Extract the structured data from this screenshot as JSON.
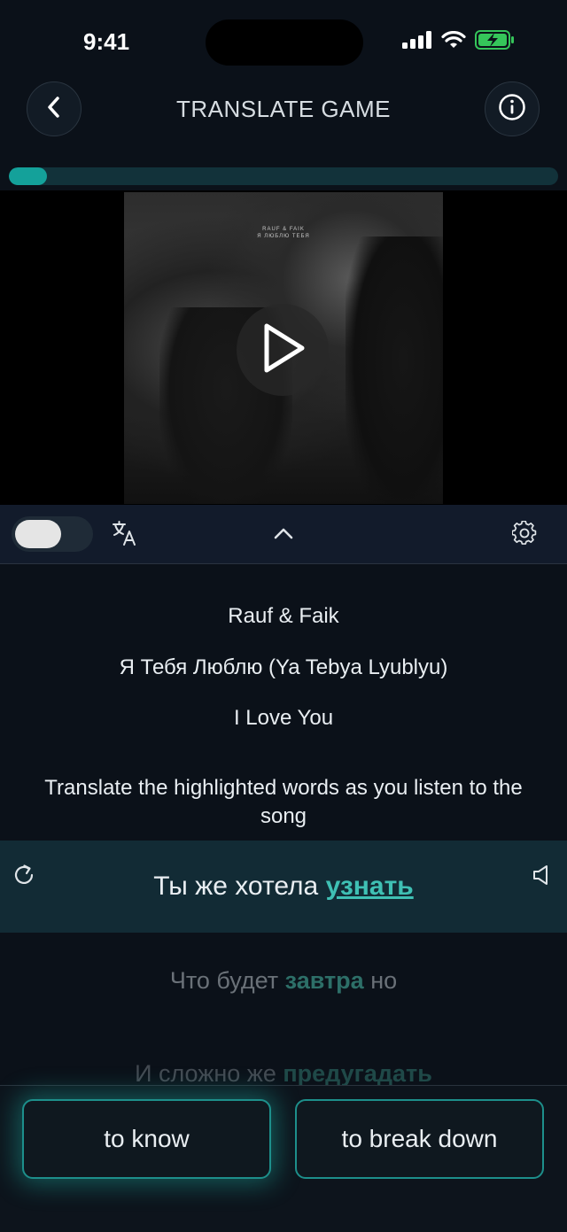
{
  "status": {
    "time": "9:41"
  },
  "header": {
    "title": "TRANSLATE GAME"
  },
  "progress": {
    "fraction": 0.07
  },
  "cover": {
    "text_line1": "RAUF & FAIK",
    "text_line2": "Я ЛЮБЛЮ ТЕБЯ"
  },
  "song": {
    "artist": "Rauf & Faik",
    "title": "Я Тебя Люблю (Ya Tebya Lyublyu)",
    "translation": "I Love You"
  },
  "instructions": "Translate the highlighted words as you listen to the song",
  "lyrics": {
    "current_plain": "Ты же хотела ",
    "current_highlight": "узнать",
    "next_plain_before": "Что будет ",
    "next_highlight": "завтра",
    "next_plain_after": " но",
    "faded_plain": "И сложно же ",
    "faded_highlight": "предугадать"
  },
  "answers": [
    "to know",
    "to break down"
  ],
  "colors": {
    "accent": "#3fc0b4",
    "progress": "#14a19a",
    "background": "#0b1119"
  }
}
